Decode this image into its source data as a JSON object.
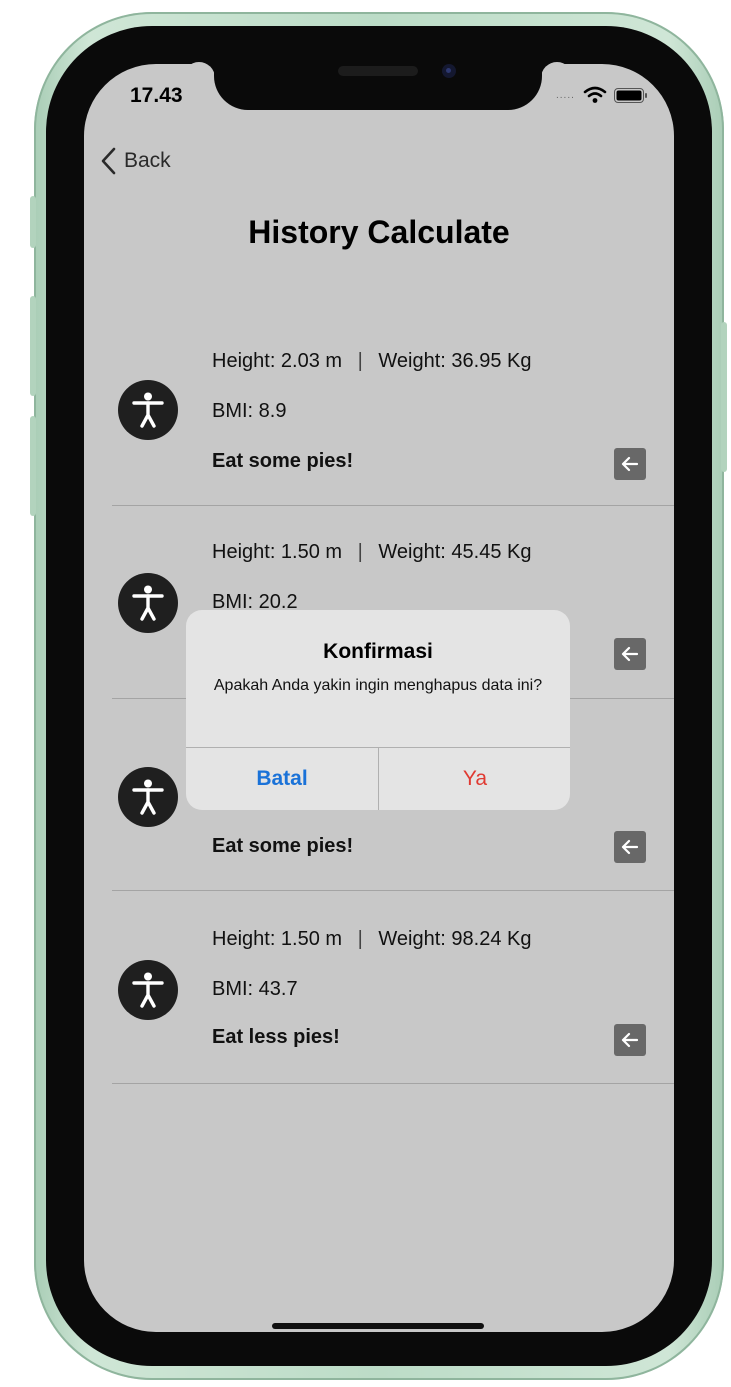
{
  "status_bar": {
    "time": "17.43",
    "signal": "....."
  },
  "nav": {
    "back_label": "Back"
  },
  "page": {
    "title": "History Calculate"
  },
  "entries": [
    {
      "height": "Height: 2.03 m",
      "weight": "Weight: 36.95 Kg",
      "bmi": "BMI: 8.9",
      "advice": "Eat some pies!"
    },
    {
      "height": "Height: 1.50 m",
      "weight": "Weight: 45.45 Kg",
      "bmi": "BMI: 20.2",
      "advice": ""
    },
    {
      "height": "",
      "weight": "",
      "bmi": "",
      "advice": "Eat some pies!"
    },
    {
      "height": "Height: 1.50 m",
      "weight": "Weight: 98.24 Kg",
      "bmi": "BMI: 43.7",
      "advice": "Eat less pies!"
    }
  ],
  "separator": "|",
  "alert": {
    "title": "Konfirmasi",
    "message": "Apakah Anda yakin ingin menghapus data ini?",
    "cancel_label": "Batal",
    "confirm_label": "Ya"
  },
  "icons": {
    "avatar": "accessibility-person-icon",
    "delete": "arrow-left-icon",
    "back": "chevron-left-icon"
  },
  "colors": {
    "screen_bg": "#c8c8c8",
    "cancel": "#1a72d8",
    "confirm": "#e03a32",
    "frame": "#bcdcc7"
  }
}
